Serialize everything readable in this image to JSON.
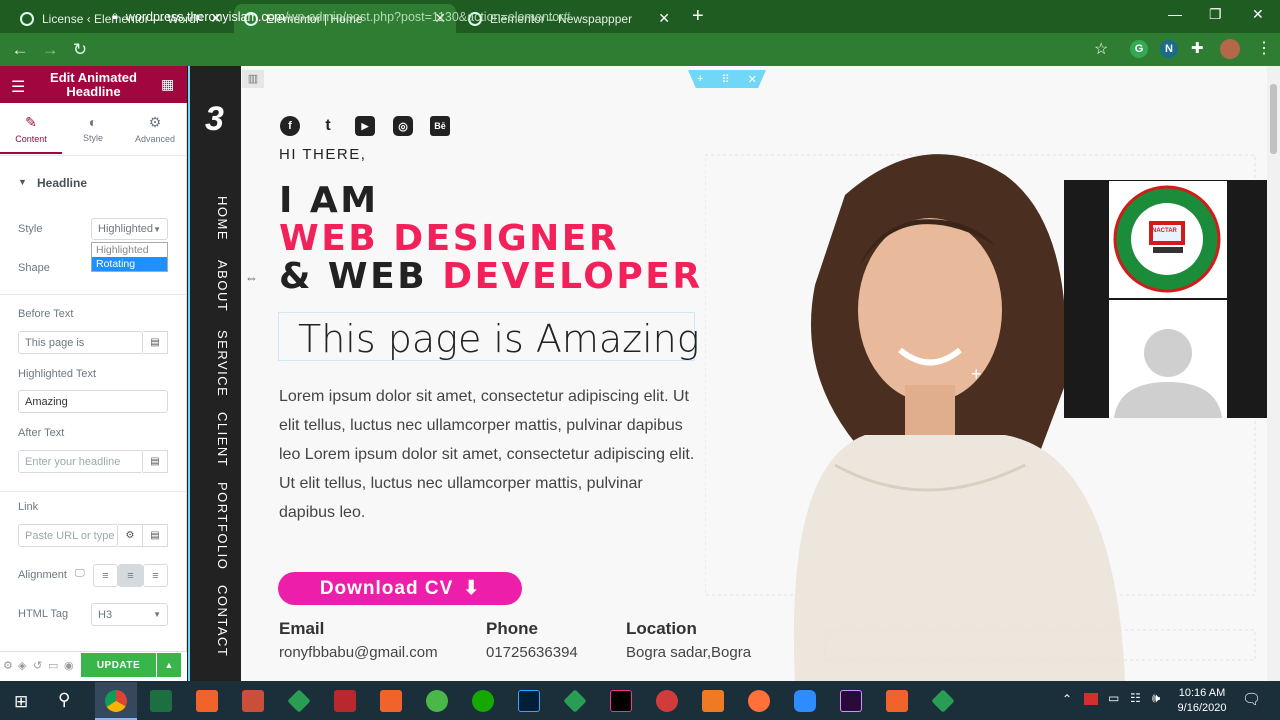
{
  "browser": {
    "tabs": [
      {
        "title": "License ‹ Elementor — WordPres",
        "active": false
      },
      {
        "title": "Elementor | Home",
        "active": true
      },
      {
        "title": "Elementor – Newspappper",
        "active": false
      }
    ],
    "url_host": "wordpress.theronyislam.com",
    "url_path": "/wp-admin/post.php?post=1130&action=elementor#",
    "ext_g": "G",
    "ext_n": "N"
  },
  "panel": {
    "title": "Edit Animated Headline",
    "tabs": [
      {
        "label": "Content",
        "icon": "✎"
      },
      {
        "label": "Style",
        "icon": "◐"
      },
      {
        "label": "Advanced",
        "icon": "⚙"
      }
    ],
    "section": "Headline",
    "style_label": "Style",
    "style_value": "Highlighted",
    "dropdown_options": [
      "Highlighted",
      "Rotating"
    ],
    "shape_label": "Shape",
    "before_label": "Before Text",
    "before_value": "This page is",
    "highlighted_label": "Highlighted Text",
    "highlighted_value": "Amazing",
    "after_label": "After Text",
    "after_placeholder": "Enter your headline",
    "link_label": "Link",
    "link_placeholder": "Paste URL or type",
    "alignment_label": "Alignment",
    "html_tag_label": "HTML Tag",
    "html_tag_value": "H3",
    "update_label": "UPDATE"
  },
  "site": {
    "nav": [
      "HOME",
      "ABOUT",
      "SERVICE",
      "CLIENT",
      "PORTFOLIO",
      "CONTACT"
    ],
    "logo": "3",
    "social": [
      "f",
      "t",
      "▶",
      "◎",
      "Bē"
    ],
    "greeting": "HI THERE,",
    "line1": "I AM",
    "line2": "WEB DESIGNER",
    "line3_a": "& WEB ",
    "line3_b": "DEVELOPER",
    "animated": "This page is Amazing",
    "lorem": "Lorem ipsum dolor sit amet, consectetur adipiscing elit. Ut elit tellus, luctus nec ullamcorper mattis, pulvinar dapibus leo Lorem ipsum dolor sit amet, consectetur adipiscing elit. Ut elit tellus, luctus nec ullamcorper mattis, pulvinar dapibus leo.",
    "cta": "Download CV",
    "contacts": [
      {
        "label": "Email",
        "value": "ronyfbbabu@gmail.com"
      },
      {
        "label": "Phone",
        "value": "01725636394"
      },
      {
        "label": "Location",
        "value": "Bogra sadar,Bogra"
      }
    ],
    "seal_text": "NACTAR"
  },
  "taskbar": {
    "time": "10:16 AM",
    "date": "9/16/2020"
  },
  "colors": {
    "accent": "#f3215a",
    "elementor": "#a1063f",
    "cta": "#ed1ea9",
    "chrome": "#2e7d32"
  }
}
